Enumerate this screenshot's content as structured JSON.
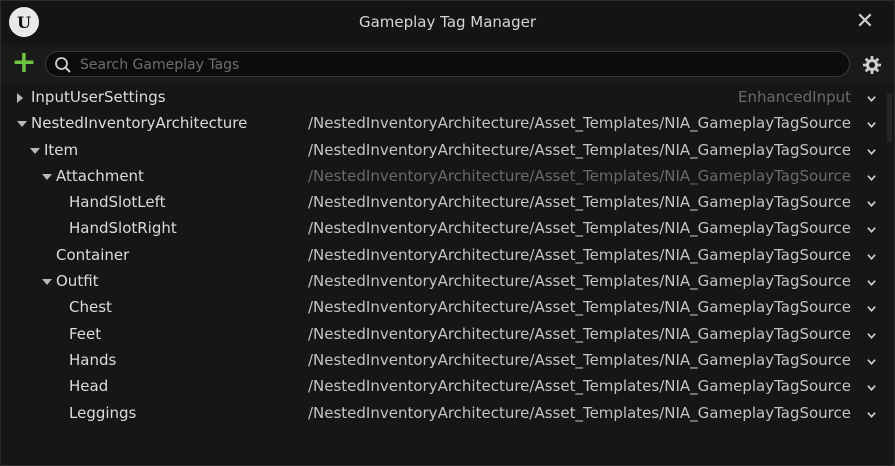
{
  "window": {
    "title": "Gameplay Tag Manager",
    "close_glyph": "✕",
    "logo_glyph": "U"
  },
  "toolbar": {
    "add_glyph": "+",
    "search_placeholder": "Search Gameplay Tags"
  },
  "colors": {
    "accent_add": "#6fc343",
    "text": "#dcdcdc",
    "dim_source": "#6a6a6a"
  },
  "rows": [
    {
      "label": "InputUserSettings",
      "depth": 0,
      "arrow": "collapsed",
      "source": "EnhancedInput",
      "dim": true
    },
    {
      "label": "NestedInventoryArchitecture",
      "depth": 0,
      "arrow": "expanded",
      "source": "/NestedInventoryArchitecture/Asset_Templates/NIA_GameplayTagSource",
      "dim": false
    },
    {
      "label": "Item",
      "depth": 1,
      "arrow": "expanded",
      "source": "/NestedInventoryArchitecture/Asset_Templates/NIA_GameplayTagSource",
      "dim": false
    },
    {
      "label": "Attachment",
      "depth": 2,
      "arrow": "expanded",
      "source": "/NestedInventoryArchitecture/Asset_Templates/NIA_GameplayTagSource",
      "dim": true
    },
    {
      "label": "HandSlotLeft",
      "depth": 3,
      "arrow": "none",
      "source": "/NestedInventoryArchitecture/Asset_Templates/NIA_GameplayTagSource",
      "dim": false
    },
    {
      "label": "HandSlotRight",
      "depth": 3,
      "arrow": "none",
      "source": "/NestedInventoryArchitecture/Asset_Templates/NIA_GameplayTagSource",
      "dim": false
    },
    {
      "label": "Container",
      "depth": 2,
      "arrow": "none",
      "source": "/NestedInventoryArchitecture/Asset_Templates/NIA_GameplayTagSource",
      "dim": false
    },
    {
      "label": "Outfit",
      "depth": 2,
      "arrow": "expanded",
      "source": "/NestedInventoryArchitecture/Asset_Templates/NIA_GameplayTagSource",
      "dim": false
    },
    {
      "label": "Chest",
      "depth": 3,
      "arrow": "none",
      "source": "/NestedInventoryArchitecture/Asset_Templates/NIA_GameplayTagSource",
      "dim": false
    },
    {
      "label": "Feet",
      "depth": 3,
      "arrow": "none",
      "source": "/NestedInventoryArchitecture/Asset_Templates/NIA_GameplayTagSource",
      "dim": false
    },
    {
      "label": "Hands",
      "depth": 3,
      "arrow": "none",
      "source": "/NestedInventoryArchitecture/Asset_Templates/NIA_GameplayTagSource",
      "dim": false
    },
    {
      "label": "Head",
      "depth": 3,
      "arrow": "none",
      "source": "/NestedInventoryArchitecture/Asset_Templates/NIA_GameplayTagSource",
      "dim": false
    },
    {
      "label": "Leggings",
      "depth": 3,
      "arrow": "none",
      "source": "/NestedInventoryArchitecture/Asset_Templates/NIA_GameplayTagSource",
      "dim": false
    }
  ]
}
